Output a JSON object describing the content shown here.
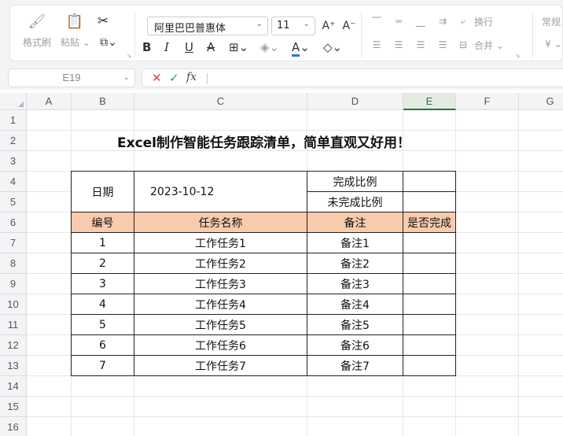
{
  "ribbon": {
    "format_painter": "格式刷",
    "paste": "粘贴",
    "font_name": "阿里巴巴普惠体",
    "font_size": "11",
    "wrap_text": "换行",
    "merge": "合并",
    "normal_style": "常规"
  },
  "formula_bar": {
    "name_box": "E19",
    "formula": ""
  },
  "columns": [
    "A",
    "B",
    "C",
    "D",
    "E",
    "F",
    "G"
  ],
  "selected_column": "E",
  "rows": [
    "1",
    "2",
    "3",
    "4",
    "5",
    "6",
    "7",
    "8",
    "9",
    "10",
    "11",
    "12",
    "13",
    "14",
    "15",
    "16"
  ],
  "sheet": {
    "title": "Excel制作智能任务跟踪清单，简单直观又好用！",
    "date_label": "日期",
    "date_value": "2023-10-12",
    "complete_ratio_label": "完成比例",
    "incomplete_ratio_label": "未完成比例",
    "headers": {
      "number": "编号",
      "task_name": "任务名称",
      "note": "备注",
      "done": "是否完成"
    },
    "tasks": [
      {
        "no": "1",
        "name": "工作任务1",
        "note": "备注1"
      },
      {
        "no": "2",
        "name": "工作任务2",
        "note": "备注2"
      },
      {
        "no": "3",
        "name": "工作任务3",
        "note": "备注3"
      },
      {
        "no": "4",
        "name": "工作任务4",
        "note": "备注4"
      },
      {
        "no": "5",
        "name": "工作任务5",
        "note": "备注5"
      },
      {
        "no": "6",
        "name": "工作任务6",
        "note": "备注6"
      },
      {
        "no": "7",
        "name": "工作任务7",
        "note": "备注7"
      }
    ]
  }
}
